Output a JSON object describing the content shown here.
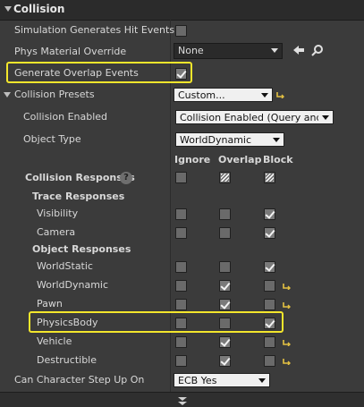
{
  "header": {
    "title": "Collision"
  },
  "sim_hit": {
    "label": "Simulation Generates Hit Events"
  },
  "phys_mat": {
    "label": "Phys Material Override",
    "value": "None"
  },
  "overlap": {
    "label": "Generate Overlap Events"
  },
  "presets": {
    "label": "Collision Presets",
    "value": "Custom..."
  },
  "enabled": {
    "label": "Collision Enabled",
    "value": "Collision Enabled (Query and Physics)"
  },
  "object_type": {
    "label": "Object Type",
    "value": "WorldDynamic"
  },
  "columns": {
    "ignore": "Ignore",
    "overlap": "Overlap",
    "block": "Block"
  },
  "responses": {
    "label": "Collision Responses",
    "help_glyph": "?"
  },
  "trace": {
    "label": "Trace Responses"
  },
  "object_resp": {
    "label": "Object Responses"
  },
  "channels": [
    {
      "label": "Visibility",
      "response": "block",
      "modified": false
    },
    {
      "label": "Camera",
      "response": "block",
      "modified": false
    },
    {
      "label": "WorldStatic",
      "response": "block",
      "modified": false
    },
    {
      "label": "WorldDynamic",
      "response": "overlap",
      "modified": true
    },
    {
      "label": "Pawn",
      "response": "overlap",
      "modified": true
    },
    {
      "label": "PhysicsBody",
      "response": "block",
      "modified": false
    },
    {
      "label": "Vehicle",
      "response": "overlap",
      "modified": true
    },
    {
      "label": "Destructible",
      "response": "overlap",
      "modified": true
    }
  ],
  "step_up": {
    "label": "Can Character Step Up On",
    "value": "ECB Yes"
  }
}
